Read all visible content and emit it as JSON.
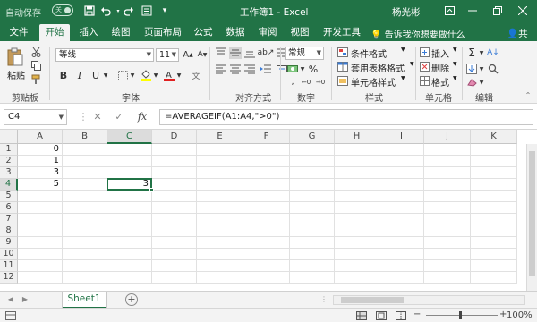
{
  "titlebar": {
    "autosave": "自动保存",
    "autosave_state": "关",
    "title": "工作簿1  -  Excel",
    "user": "杨光彬"
  },
  "tabs": [
    "文件",
    "开始",
    "插入",
    "绘图",
    "页面布局",
    "公式",
    "数据",
    "审阅",
    "视图",
    "开发工具"
  ],
  "active_tab": "开始",
  "tell_me": "告诉我你想要做什么",
  "share": "共享",
  "ribbon": {
    "clipboard": {
      "paste": "粘贴",
      "label": "剪贴板"
    },
    "font": {
      "name": "等线",
      "size": "11",
      "label": "字体"
    },
    "alignment": {
      "label": "对齐方式"
    },
    "number": {
      "format": "常规",
      "label": "数字"
    },
    "styles": {
      "conditional": "条件格式",
      "table": "套用表格格式",
      "cell_styles": "单元格样式",
      "label": "样式"
    },
    "cells": {
      "insert": "插入",
      "delete": "删除",
      "format": "格式",
      "label": "单元格"
    },
    "editing": {
      "label": "编辑"
    }
  },
  "formula_bar": {
    "name_box": "C4",
    "formula": "=AVERAGEIF(A1:A4,\">0\")"
  },
  "grid": {
    "columns": [
      "A",
      "B",
      "C",
      "D",
      "E",
      "F",
      "G",
      "H",
      "I",
      "J",
      "K"
    ],
    "rows": [
      "1",
      "2",
      "3",
      "4",
      "5",
      "6",
      "7",
      "8",
      "9",
      "10",
      "11",
      "12"
    ],
    "cells": {
      "A1": "0",
      "A2": "1",
      "A3": "3",
      "A4": "5",
      "C4": "3"
    },
    "selected": "C4"
  },
  "sheets": [
    "Sheet1"
  ],
  "status": {
    "zoom": "100%",
    "zoom_level": 1.0
  },
  "colors": {
    "accent": "#217346"
  }
}
